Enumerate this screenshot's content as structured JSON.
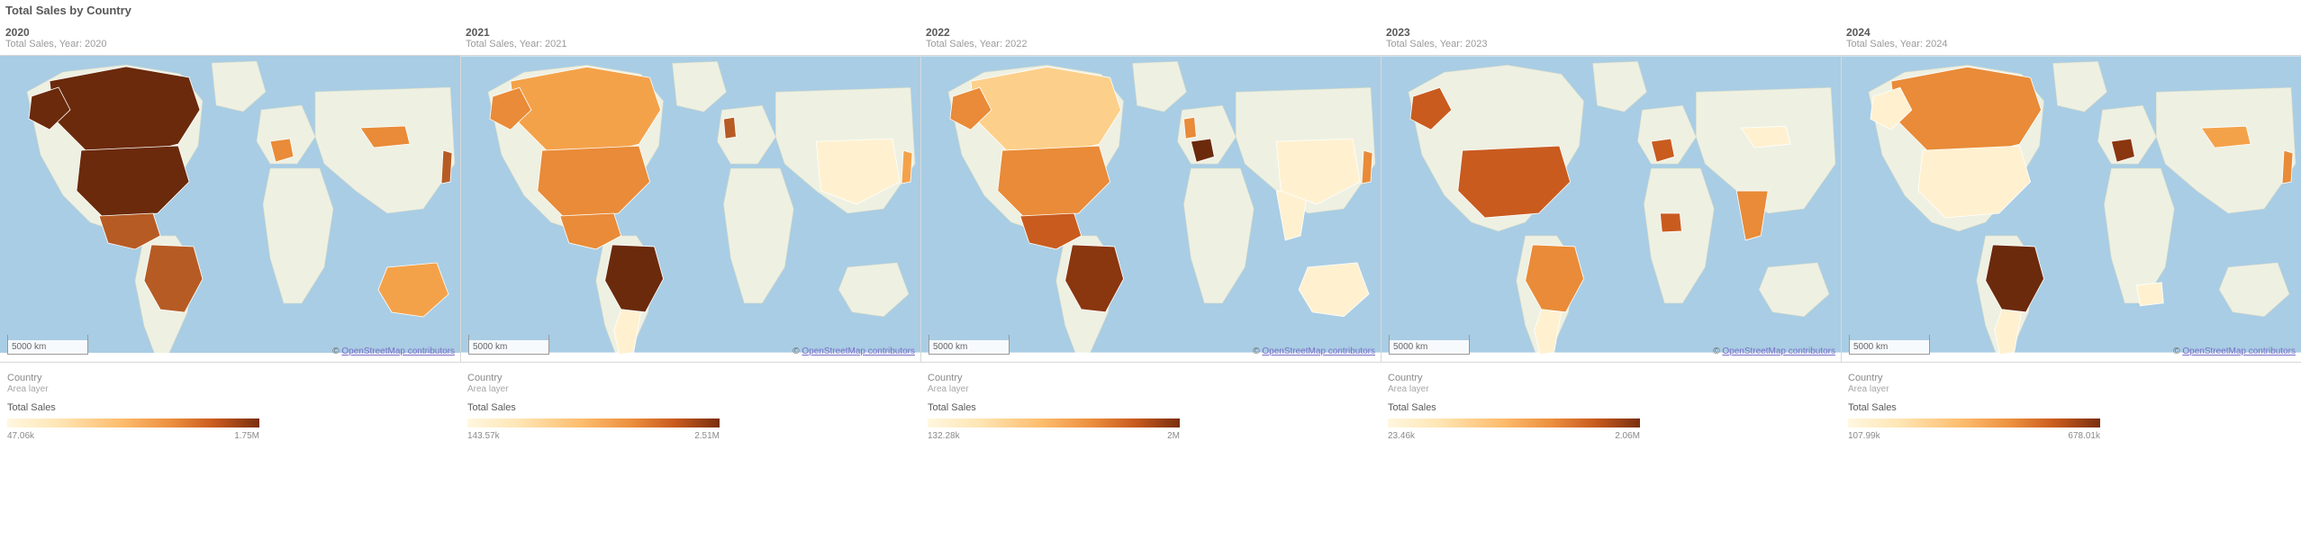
{
  "title": "Total Sales by Country",
  "chart_data": [
    {
      "type": "map",
      "year": "2020",
      "subtitle_prefix": "Total Sales, Year: ",
      "legend_layer": "Country",
      "legend_sublayer": "Area layer",
      "legend_metric": "Total Sales",
      "scale_label": "5000 km",
      "attribution_prefix": "© ",
      "attribution_link": "OpenStreetMap contributors",
      "legend_min": "47.06k",
      "legend_max": "1.75M",
      "countries": [
        {
          "name": "Canada",
          "value_color": "#6b2a0b"
        },
        {
          "name": "United States",
          "value_color": "#6b2a0b"
        },
        {
          "name": "Mexico",
          "value_color": "#b75b24"
        },
        {
          "name": "Brazil",
          "value_color": "#b75b24"
        },
        {
          "name": "Australia",
          "value_color": "#f4a24a"
        },
        {
          "name": "Mongolia",
          "value_color": "#e98b38"
        },
        {
          "name": "France",
          "value_color": "#e98b38"
        },
        {
          "name": "Japan",
          "value_color": "#b75b24"
        }
      ]
    },
    {
      "type": "map",
      "year": "2021",
      "subtitle_prefix": "Total Sales, Year: ",
      "legend_layer": "Country",
      "legend_sublayer": "Area layer",
      "legend_metric": "Total Sales",
      "scale_label": "5000 km",
      "attribution_prefix": "© ",
      "attribution_link": "OpenStreetMap contributors",
      "legend_min": "143.57k",
      "legend_max": "2.51M",
      "countries": [
        {
          "name": "Canada",
          "value_color": "#f4a24a"
        },
        {
          "name": "United States",
          "value_color": "#e98b38"
        },
        {
          "name": "Mexico",
          "value_color": "#e98b38"
        },
        {
          "name": "Brazil",
          "value_color": "#6b2a0b"
        },
        {
          "name": "Argentina",
          "value_color": "#fff1d0"
        },
        {
          "name": "United Kingdom",
          "value_color": "#b75b24"
        },
        {
          "name": "China",
          "value_color": "#fff1d0"
        },
        {
          "name": "Japan",
          "value_color": "#f4a24a"
        }
      ]
    },
    {
      "type": "map",
      "year": "2022",
      "subtitle_prefix": "Total Sales, Year: ",
      "legend_layer": "Country",
      "legend_sublayer": "Area layer",
      "legend_metric": "Total Sales",
      "scale_label": "5000 km",
      "attribution_prefix": "© ",
      "attribution_link": "OpenStreetMap contributors",
      "legend_min": "132.28k",
      "legend_max": "2M",
      "countries": [
        {
          "name": "Canada",
          "value_color": "#fcd08a"
        },
        {
          "name": "United States",
          "value_color": "#e98b38"
        },
        {
          "name": "Mexico",
          "value_color": "#c95b1f"
        },
        {
          "name": "Brazil",
          "value_color": "#8a360f"
        },
        {
          "name": "Australia",
          "value_color": "#fff1d0"
        },
        {
          "name": "United Kingdom",
          "value_color": "#e98b38"
        },
        {
          "name": "France",
          "value_color": "#6b2a0b"
        },
        {
          "name": "India",
          "value_color": "#fff1d0"
        },
        {
          "name": "China",
          "value_color": "#fff1d0"
        },
        {
          "name": "Japan",
          "value_color": "#e98b38"
        }
      ]
    },
    {
      "type": "map",
      "year": "2023",
      "subtitle_prefix": "Total Sales, Year: ",
      "legend_layer": "Country",
      "legend_sublayer": "Area layer",
      "legend_metric": "Total Sales",
      "scale_label": "5000 km",
      "attribution_prefix": "© ",
      "attribution_link": "OpenStreetMap contributors",
      "legend_min": "23.46k",
      "legend_max": "2.06M",
      "countries": [
        {
          "name": "United States",
          "value_color": "#c95b1f"
        },
        {
          "name": "Brazil",
          "value_color": "#e98b38"
        },
        {
          "name": "Argentina",
          "value_color": "#fff1d0"
        },
        {
          "name": "France",
          "value_color": "#c95b1f"
        },
        {
          "name": "Nigeria",
          "value_color": "#c95b1f"
        },
        {
          "name": "India",
          "value_color": "#e98b38"
        },
        {
          "name": "Mongolia",
          "value_color": "#fff1d0"
        }
      ]
    },
    {
      "type": "map",
      "year": "2024",
      "subtitle_prefix": "Total Sales, Year: ",
      "legend_layer": "Country",
      "legend_sublayer": "Area layer",
      "legend_metric": "Total Sales",
      "scale_label": "5000 km",
      "attribution_prefix": "© ",
      "attribution_link": "OpenStreetMap contributors",
      "legend_min": "107.99k",
      "legend_max": "678.01k",
      "countries": [
        {
          "name": "Canada",
          "value_color": "#e98b38"
        },
        {
          "name": "United States",
          "value_color": "#fff1d0"
        },
        {
          "name": "Brazil",
          "value_color": "#6b2a0b"
        },
        {
          "name": "Argentina",
          "value_color": "#fff1d0"
        },
        {
          "name": "France",
          "value_color": "#8a360f"
        },
        {
          "name": "South Africa",
          "value_color": "#fff1d0"
        },
        {
          "name": "Mongolia",
          "value_color": "#f4a24a"
        },
        {
          "name": "Japan",
          "value_color": "#e98b38"
        }
      ]
    }
  ]
}
